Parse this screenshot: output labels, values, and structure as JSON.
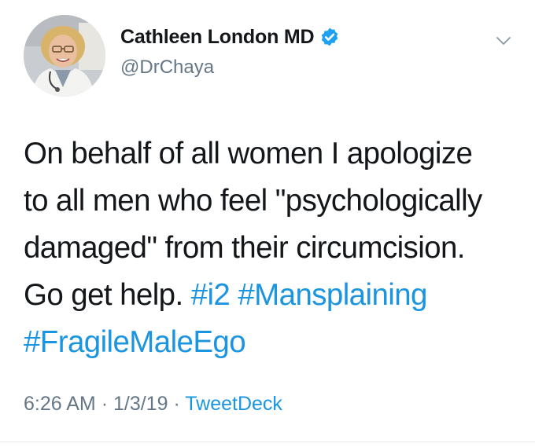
{
  "tweet": {
    "author": {
      "display_name": "Cathleen London MD",
      "handle": "@DrChaya",
      "verified": true
    },
    "text_lines": [
      "On behalf of all women I apologize",
      "to all men who feel \"psychologically",
      "damaged\" from their circumcision.",
      "Go get help."
    ],
    "hashtags": [
      "#i2",
      "#Mansplaining",
      "#FragileMaleEgo"
    ],
    "meta": {
      "time": "6:26 AM",
      "date": "1/3/19",
      "source": "TweetDeck",
      "separator": "·"
    }
  },
  "icons": {
    "verified": "verified-badge-icon",
    "menu": "chevron-down-icon",
    "avatar": "profile-photo"
  },
  "colors": {
    "text": "#14171a",
    "secondary": "#657786",
    "link": "#1b95e0",
    "verified": "#1da1f2"
  }
}
